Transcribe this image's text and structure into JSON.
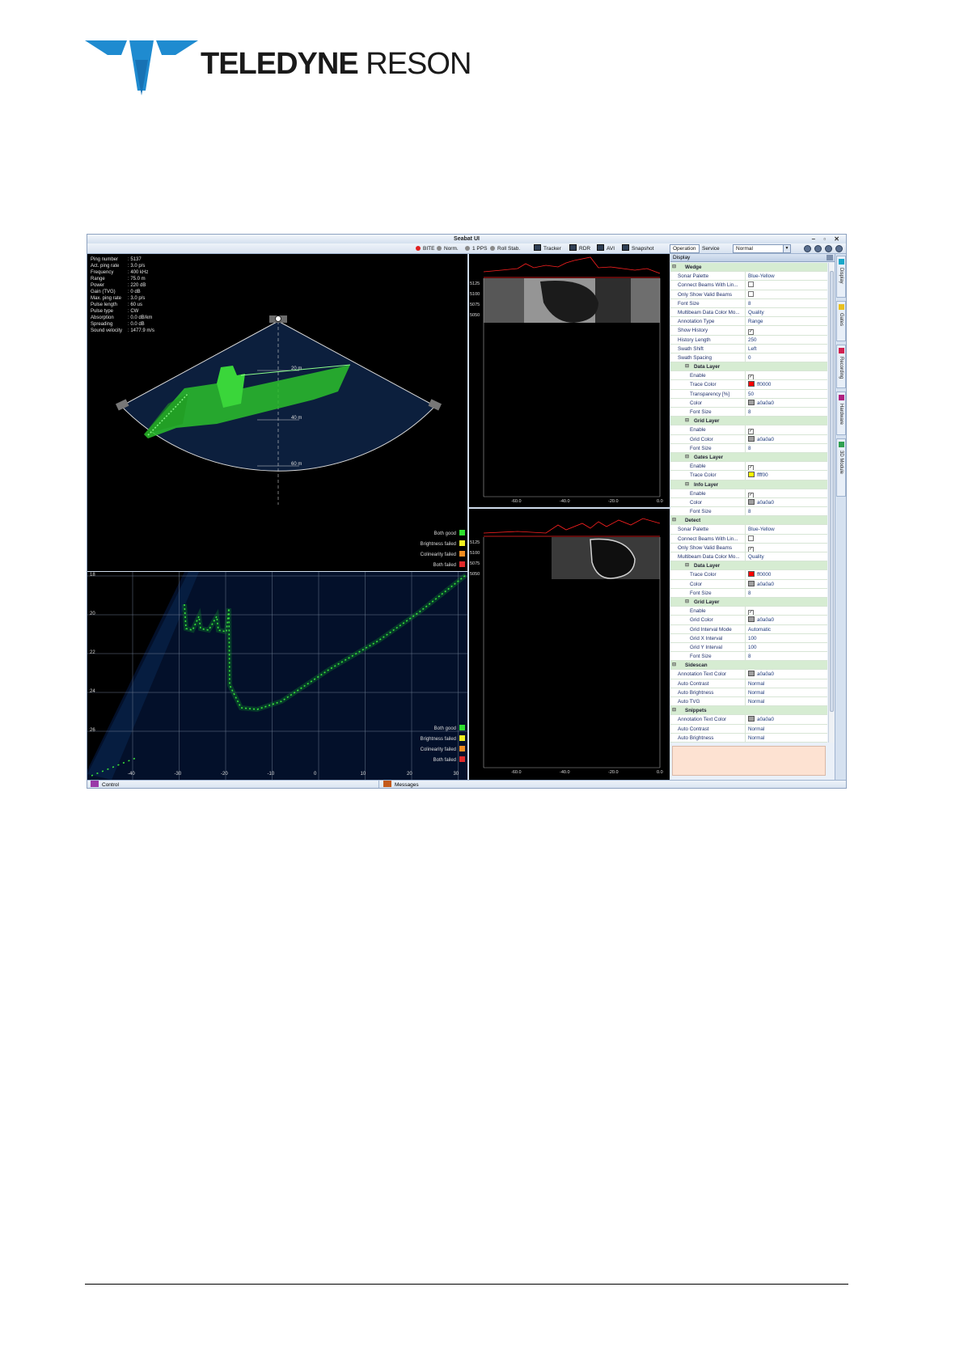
{
  "logo": {
    "brand_bold": "TELEDYNE",
    "brand_light": "RESON"
  },
  "window": {
    "title": "Seabat UI",
    "controls": "– ▫ ✕"
  },
  "toolbar": {
    "indicators": [
      {
        "label": "BITE",
        "color": "#e02020"
      },
      {
        "label": "Norm.",
        "color": "#8a8a8a"
      },
      {
        "label": "1 PPS",
        "color": "#8a8a8a"
      },
      {
        "label": "Roll Stab.",
        "color": "#8a8a8a"
      }
    ],
    "buttons": [
      {
        "label": "Tracker"
      },
      {
        "label": "RDR"
      },
      {
        "label": "AVI"
      },
      {
        "label": "Snapshot"
      }
    ],
    "mode_tabs": [
      {
        "label": "Operation"
      },
      {
        "label": "Service"
      }
    ],
    "mode_select": "Normal",
    "arrow_glyph": "▼"
  },
  "wedge_view": {
    "info": [
      {
        "k": "Ping number",
        "v": ": 5137"
      },
      {
        "k": "Act. ping rate",
        "v": ": 3.0 p/s"
      },
      {
        "k": "Frequency",
        "v": ": 400 kHz"
      },
      {
        "k": "Range",
        "v": ": 75.0 m"
      },
      {
        "k": "Power",
        "v": ": 220 dB"
      },
      {
        "k": "Gain (TVG)",
        "v": ": 0 dB"
      },
      {
        "k": "Max. ping rate",
        "v": ": 3.0 p/s"
      },
      {
        "k": "Pulse length",
        "v": ": 60 us"
      },
      {
        "k": "Pulse type",
        "v": ": CW"
      },
      {
        "k": "Absorption",
        "v": ": 0.0 dB/km"
      },
      {
        "k": "Spreading",
        "v": ": 0.0 dB"
      },
      {
        "k": "Sound velocity",
        "v": ": 1477.9 m/s"
      }
    ],
    "range_labels": [
      "20 m",
      "40 m",
      "60 m"
    ],
    "legend": [
      {
        "label": "Both good",
        "color": "#2ee02e"
      },
      {
        "label": "Brightness failed",
        "color": "#f0f020"
      },
      {
        "label": "Colinearity failed",
        "color": "#f08c20"
      },
      {
        "label": "Both failed",
        "color": "#e02a2a"
      }
    ]
  },
  "profile_view": {
    "y_ticks": [
      "18",
      "20",
      "22",
      "24",
      "26"
    ],
    "x_ticks": [
      "-40",
      "-30",
      "-20",
      "-10",
      "0",
      "10",
      "20",
      "30"
    ],
    "legend": [
      {
        "label": "Both good",
        "color": "#2ee02e"
      },
      {
        "label": "Brightness failed",
        "color": "#f0f020"
      },
      {
        "label": "Colinearity failed",
        "color": "#f08c20"
      },
      {
        "label": "Both failed",
        "color": "#e02a2a"
      }
    ]
  },
  "sidescan_top": {
    "y_ticks": [
      "5125",
      "5100",
      "5075",
      "5050"
    ],
    "x_ticks": [
      "-60.0",
      "-40.0",
      "-20.0",
      "0.0"
    ]
  },
  "sidescan_bottom": {
    "y_ticks": [
      "5125",
      "5100",
      "5075",
      "5050"
    ],
    "x_ticks": [
      "-60.0",
      "-40.0",
      "-20.0",
      "0.0"
    ]
  },
  "properties": {
    "title": "Display",
    "rows": [
      {
        "cat": true,
        "level": 1,
        "name": "Wedge"
      },
      {
        "level": 1,
        "name": "Sonar Palette",
        "val": "Blue-Yellow"
      },
      {
        "level": 1,
        "name": "Connect Beams With Lin...",
        "chk": ""
      },
      {
        "level": 1,
        "name": "Only Show Valid Beams",
        "chk": ""
      },
      {
        "level": 1,
        "name": "Font Size",
        "val": "8"
      },
      {
        "level": 1,
        "name": "Multibeam Data Color Mo...",
        "val": "Quality"
      },
      {
        "level": 1,
        "name": "Annotation Type",
        "val": "Range"
      },
      {
        "level": 1,
        "name": "Show History",
        "chk": "✓"
      },
      {
        "level": 1,
        "name": "History Length",
        "val": "250"
      },
      {
        "level": 1,
        "name": "Swath Shift",
        "val": "Left"
      },
      {
        "level": 1,
        "name": "Swath Spacing",
        "val": "0"
      },
      {
        "cat": true,
        "level": 2,
        "name": "Data Layer"
      },
      {
        "level": 2,
        "name": "Enable",
        "chk": "✓"
      },
      {
        "level": 2,
        "name": "Trace Color",
        "color": "#ff0000",
        "val": "ff0000"
      },
      {
        "level": 2,
        "name": "Transparency [%]",
        "val": "50"
      },
      {
        "level": 2,
        "name": "Color",
        "color": "#a0a0a0",
        "val": "a0a0a0"
      },
      {
        "level": 2,
        "name": "Font Size",
        "val": "8"
      },
      {
        "cat": true,
        "level": 2,
        "name": "Grid Layer"
      },
      {
        "level": 2,
        "name": "Enable",
        "chk": "✓"
      },
      {
        "level": 2,
        "name": "Grid Color",
        "color": "#a0a0a0",
        "val": "a0a0a0"
      },
      {
        "level": 2,
        "name": "Font Size",
        "val": "8"
      },
      {
        "cat": true,
        "level": 2,
        "name": "Gates Layer"
      },
      {
        "level": 2,
        "name": "Enable",
        "chk": "✓"
      },
      {
        "level": 2,
        "name": "Trace Color",
        "color": "#ffff00",
        "val": "ffff00"
      },
      {
        "cat": true,
        "level": 2,
        "name": "Info Layer"
      },
      {
        "level": 2,
        "name": "Enable",
        "chk": "✓"
      },
      {
        "level": 2,
        "name": "Color",
        "color": "#a0a0a0",
        "val": "a0a0a0"
      },
      {
        "level": 2,
        "name": "Font Size",
        "val": "8"
      },
      {
        "cat": true,
        "level": 1,
        "name": "Detect"
      },
      {
        "level": 1,
        "name": "Sonar Palette",
        "val": "Blue-Yellow"
      },
      {
        "level": 1,
        "name": "Connect Beams With Lin...",
        "chk": ""
      },
      {
        "level": 1,
        "name": "Only Show Valid Beams",
        "chk": "✓"
      },
      {
        "level": 1,
        "name": "Multibeam Data Color Mo...",
        "val": "Quality"
      },
      {
        "cat": true,
        "level": 2,
        "name": "Data Layer"
      },
      {
        "level": 2,
        "name": "Trace Color",
        "color": "#ff0000",
        "val": "ff0000"
      },
      {
        "level": 2,
        "name": "Color",
        "color": "#a0a0a0",
        "val": "a0a0a0"
      },
      {
        "level": 2,
        "name": "Font Size",
        "val": "8"
      },
      {
        "cat": true,
        "level": 2,
        "name": "Grid Layer"
      },
      {
        "level": 2,
        "name": "Enable",
        "chk": "✓"
      },
      {
        "level": 2,
        "name": "Grid Color",
        "color": "#a0a0a0",
        "val": "a0a0a0"
      },
      {
        "level": 2,
        "name": "Grid Interval Mode",
        "val": "Automatic"
      },
      {
        "level": 2,
        "name": "Grid X Interval",
        "val": "100"
      },
      {
        "level": 2,
        "name": "Grid Y Interval",
        "val": "100"
      },
      {
        "level": 2,
        "name": "Font Size",
        "val": "8"
      },
      {
        "cat": true,
        "level": 1,
        "name": "Sidescan"
      },
      {
        "level": 1,
        "name": "Annotation Text Color",
        "color": "#a0a0a0",
        "val": "a0a0a0"
      },
      {
        "level": 1,
        "name": "Auto Contrast",
        "val": "Normal"
      },
      {
        "level": 1,
        "name": "Auto Brightness",
        "val": "Normal"
      },
      {
        "level": 1,
        "name": "Auto TVG",
        "val": "Normal"
      },
      {
        "cat": true,
        "level": 1,
        "name": "Snippets"
      },
      {
        "level": 1,
        "name": "Annotation Text Color",
        "color": "#a0a0a0",
        "val": "a0a0a0"
      },
      {
        "level": 1,
        "name": "Auto Contrast",
        "val": "Normal"
      },
      {
        "level": 1,
        "name": "Auto Brightness",
        "val": "Normal"
      }
    ]
  },
  "side_tabs": [
    {
      "label": "Display",
      "color": "#18a7c9"
    },
    {
      "label": "Gates",
      "color": "#e8c020"
    },
    {
      "label": "Recording",
      "color": "#d02050"
    },
    {
      "label": "Hardware",
      "color": "#b02080"
    },
    {
      "label": "3D Module",
      "color": "#30a050"
    }
  ],
  "statusbar": {
    "control": "Control",
    "messages": "Messages"
  }
}
